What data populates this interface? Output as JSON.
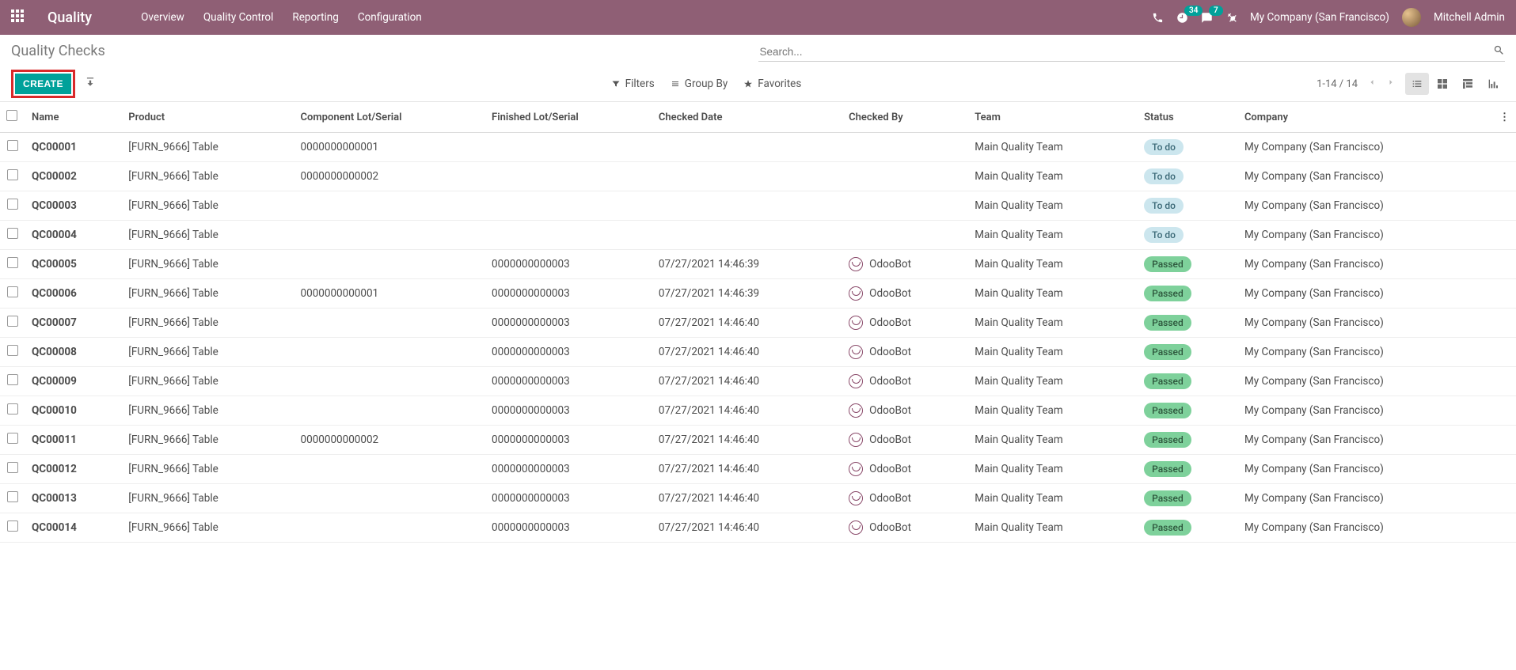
{
  "navbar": {
    "app_title": "Quality",
    "menu": [
      "Overview",
      "Quality Control",
      "Reporting",
      "Configuration"
    ],
    "notif_count": "34",
    "msg_count": "7",
    "company": "My Company (San Francisco)",
    "user": "Mitchell Admin"
  },
  "breadcrumb": "Quality Checks",
  "search": {
    "placeholder": "Search..."
  },
  "buttons": {
    "create": "CREATE"
  },
  "search_options": {
    "filters": "Filters",
    "group_by": "Group By",
    "favorites": "Favorites"
  },
  "pager": {
    "range": "1-14 / 14"
  },
  "columns": {
    "name": "Name",
    "product": "Product",
    "component": "Component Lot/Serial",
    "finished": "Finished Lot/Serial",
    "checked_date": "Checked Date",
    "checked_by": "Checked By",
    "team": "Team",
    "status": "Status",
    "company": "Company"
  },
  "status_labels": {
    "todo": "To do",
    "passed": "Passed"
  },
  "rows": [
    {
      "name": "QC00001",
      "product": "[FURN_9666] Table",
      "component": "0000000000001",
      "finished": "",
      "checked_date": "",
      "checked_by": "",
      "team": "Main Quality Team",
      "status": "todo",
      "company": "My Company (San Francisco)"
    },
    {
      "name": "QC00002",
      "product": "[FURN_9666] Table",
      "component": "0000000000002",
      "finished": "",
      "checked_date": "",
      "checked_by": "",
      "team": "Main Quality Team",
      "status": "todo",
      "company": "My Company (San Francisco)"
    },
    {
      "name": "QC00003",
      "product": "[FURN_9666] Table",
      "component": "",
      "finished": "",
      "checked_date": "",
      "checked_by": "",
      "team": "Main Quality Team",
      "status": "todo",
      "company": "My Company (San Francisco)"
    },
    {
      "name": "QC00004",
      "product": "[FURN_9666] Table",
      "component": "",
      "finished": "",
      "checked_date": "",
      "checked_by": "",
      "team": "Main Quality Team",
      "status": "todo",
      "company": "My Company (San Francisco)"
    },
    {
      "name": "QC00005",
      "product": "[FURN_9666] Table",
      "component": "",
      "finished": "0000000000003",
      "checked_date": "07/27/2021 14:46:39",
      "checked_by": "OdooBot",
      "team": "Main Quality Team",
      "status": "passed",
      "company": "My Company (San Francisco)"
    },
    {
      "name": "QC00006",
      "product": "[FURN_9666] Table",
      "component": "0000000000001",
      "finished": "0000000000003",
      "checked_date": "07/27/2021 14:46:39",
      "checked_by": "OdooBot",
      "team": "Main Quality Team",
      "status": "passed",
      "company": "My Company (San Francisco)"
    },
    {
      "name": "QC00007",
      "product": "[FURN_9666] Table",
      "component": "",
      "finished": "0000000000003",
      "checked_date": "07/27/2021 14:46:40",
      "checked_by": "OdooBot",
      "team": "Main Quality Team",
      "status": "passed",
      "company": "My Company (San Francisco)"
    },
    {
      "name": "QC00008",
      "product": "[FURN_9666] Table",
      "component": "",
      "finished": "0000000000003",
      "checked_date": "07/27/2021 14:46:40",
      "checked_by": "OdooBot",
      "team": "Main Quality Team",
      "status": "passed",
      "company": "My Company (San Francisco)"
    },
    {
      "name": "QC00009",
      "product": "[FURN_9666] Table",
      "component": "",
      "finished": "0000000000003",
      "checked_date": "07/27/2021 14:46:40",
      "checked_by": "OdooBot",
      "team": "Main Quality Team",
      "status": "passed",
      "company": "My Company (San Francisco)"
    },
    {
      "name": "QC00010",
      "product": "[FURN_9666] Table",
      "component": "",
      "finished": "0000000000003",
      "checked_date": "07/27/2021 14:46:40",
      "checked_by": "OdooBot",
      "team": "Main Quality Team",
      "status": "passed",
      "company": "My Company (San Francisco)"
    },
    {
      "name": "QC00011",
      "product": "[FURN_9666] Table",
      "component": "0000000000002",
      "finished": "0000000000003",
      "checked_date": "07/27/2021 14:46:40",
      "checked_by": "OdooBot",
      "team": "Main Quality Team",
      "status": "passed",
      "company": "My Company (San Francisco)"
    },
    {
      "name": "QC00012",
      "product": "[FURN_9666] Table",
      "component": "",
      "finished": "0000000000003",
      "checked_date": "07/27/2021 14:46:40",
      "checked_by": "OdooBot",
      "team": "Main Quality Team",
      "status": "passed",
      "company": "My Company (San Francisco)"
    },
    {
      "name": "QC00013",
      "product": "[FURN_9666] Table",
      "component": "",
      "finished": "0000000000003",
      "checked_date": "07/27/2021 14:46:40",
      "checked_by": "OdooBot",
      "team": "Main Quality Team",
      "status": "passed",
      "company": "My Company (San Francisco)"
    },
    {
      "name": "QC00014",
      "product": "[FURN_9666] Table",
      "component": "",
      "finished": "0000000000003",
      "checked_date": "07/27/2021 14:46:40",
      "checked_by": "OdooBot",
      "team": "Main Quality Team",
      "status": "passed",
      "company": "My Company (San Francisco)"
    }
  ]
}
